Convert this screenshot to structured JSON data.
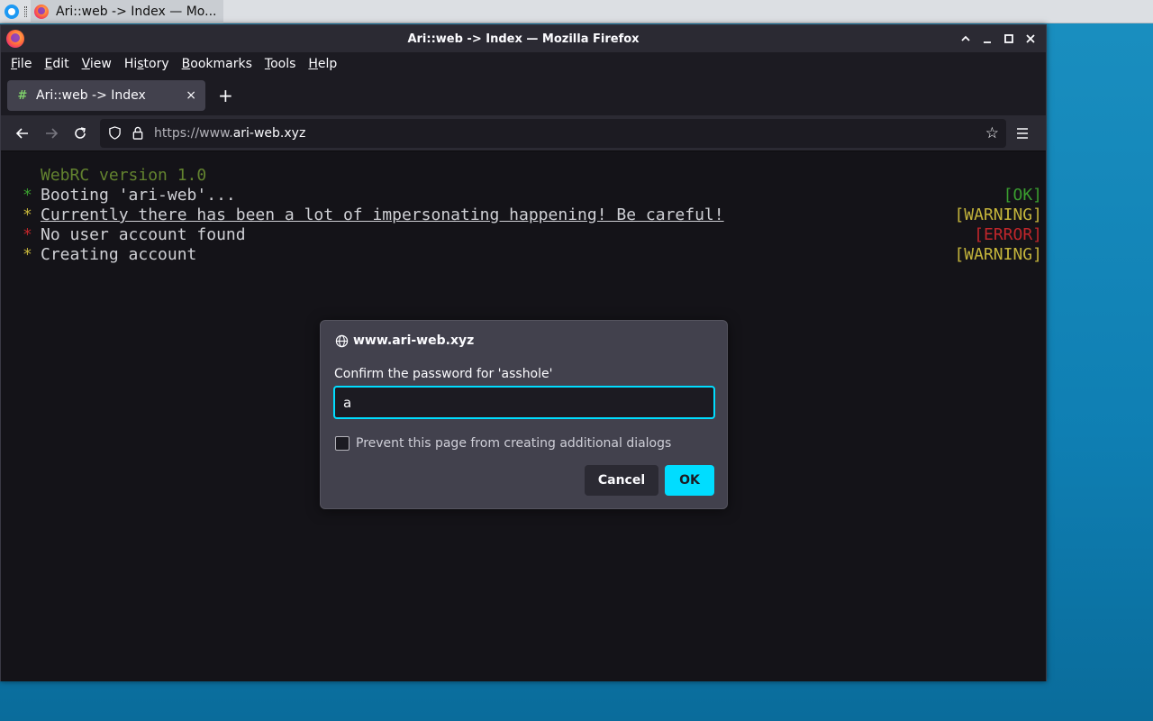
{
  "taskbar": {
    "task_label": "Ari::web -> Index — Mo..."
  },
  "window": {
    "title": "Ari::web -> Index — Mozilla Firefox"
  },
  "menubar": {
    "items": [
      {
        "mnemonic": "F",
        "rest": "ile"
      },
      {
        "mnemonic": "E",
        "rest": "dit"
      },
      {
        "mnemonic": "V",
        "rest": "iew"
      },
      {
        "pre": "Hi",
        "mnemonic": "s",
        "rest": "tory"
      },
      {
        "mnemonic": "B",
        "rest": "ookmarks"
      },
      {
        "mnemonic": "T",
        "rest": "ools"
      },
      {
        "mnemonic": "H",
        "rest": "elp"
      }
    ]
  },
  "tab": {
    "label": "Ari::web -> Index",
    "favicon": "#",
    "close": "×",
    "new_tab": "+"
  },
  "navbar": {
    "url_prefix": "https://www.",
    "url_host": "ari-web.xyz"
  },
  "terminal": {
    "version": "WebRC version 1.0",
    "lines": [
      {
        "bullet": "*",
        "text": "Booting 'ari-web'...",
        "status": "[OK]"
      },
      {
        "bullet": "*",
        "text": "Currently there has been a lot of impersonating happening! Be careful!",
        "status": "[WARNING]"
      },
      {
        "bullet": "*",
        "text": "No user account found",
        "status": "[ERROR]"
      },
      {
        "bullet": "*",
        "text": "Creating account",
        "status": "[WARNING]"
      }
    ]
  },
  "dialog": {
    "host": "www.ari-web.xyz",
    "prompt": "Confirm the password for 'asshole'",
    "input_value": "a",
    "checkbox_label": "Prevent this page from creating additional dialogs",
    "cancel_label": "Cancel",
    "ok_label": "OK"
  },
  "colors": {
    "accent": "#00ddff",
    "ok": "#3a9d2f",
    "warning": "#c4b43b",
    "error": "#c0262b"
  }
}
